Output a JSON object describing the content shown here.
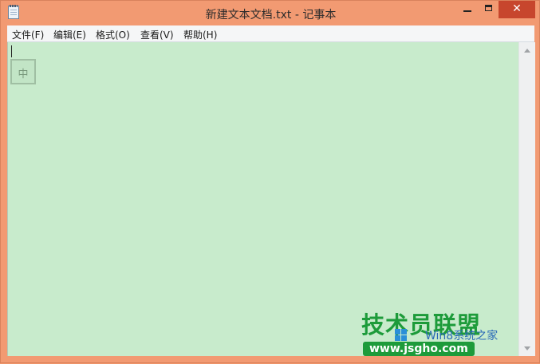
{
  "window": {
    "title": "新建文本文档.txt - 记事本",
    "close_glyph": "✕",
    "icon": "notepad-icon"
  },
  "menu": {
    "items": [
      {
        "label": "文件(F)"
      },
      {
        "label": "编辑(E)"
      },
      {
        "label": "格式(O)"
      },
      {
        "label": "查看(V)"
      },
      {
        "label": "帮助(H)"
      }
    ]
  },
  "editor": {
    "text": "",
    "ime_indicator": "中",
    "background": "#c8ebcc"
  },
  "watermark": {
    "brand": "技术员联盟",
    "sub": "Win8系统之家",
    "url": "www.jsgho.com"
  },
  "colors": {
    "frame": "#f29a72",
    "close_button": "#c7462d",
    "watermark_green": "#1d9b3a"
  }
}
